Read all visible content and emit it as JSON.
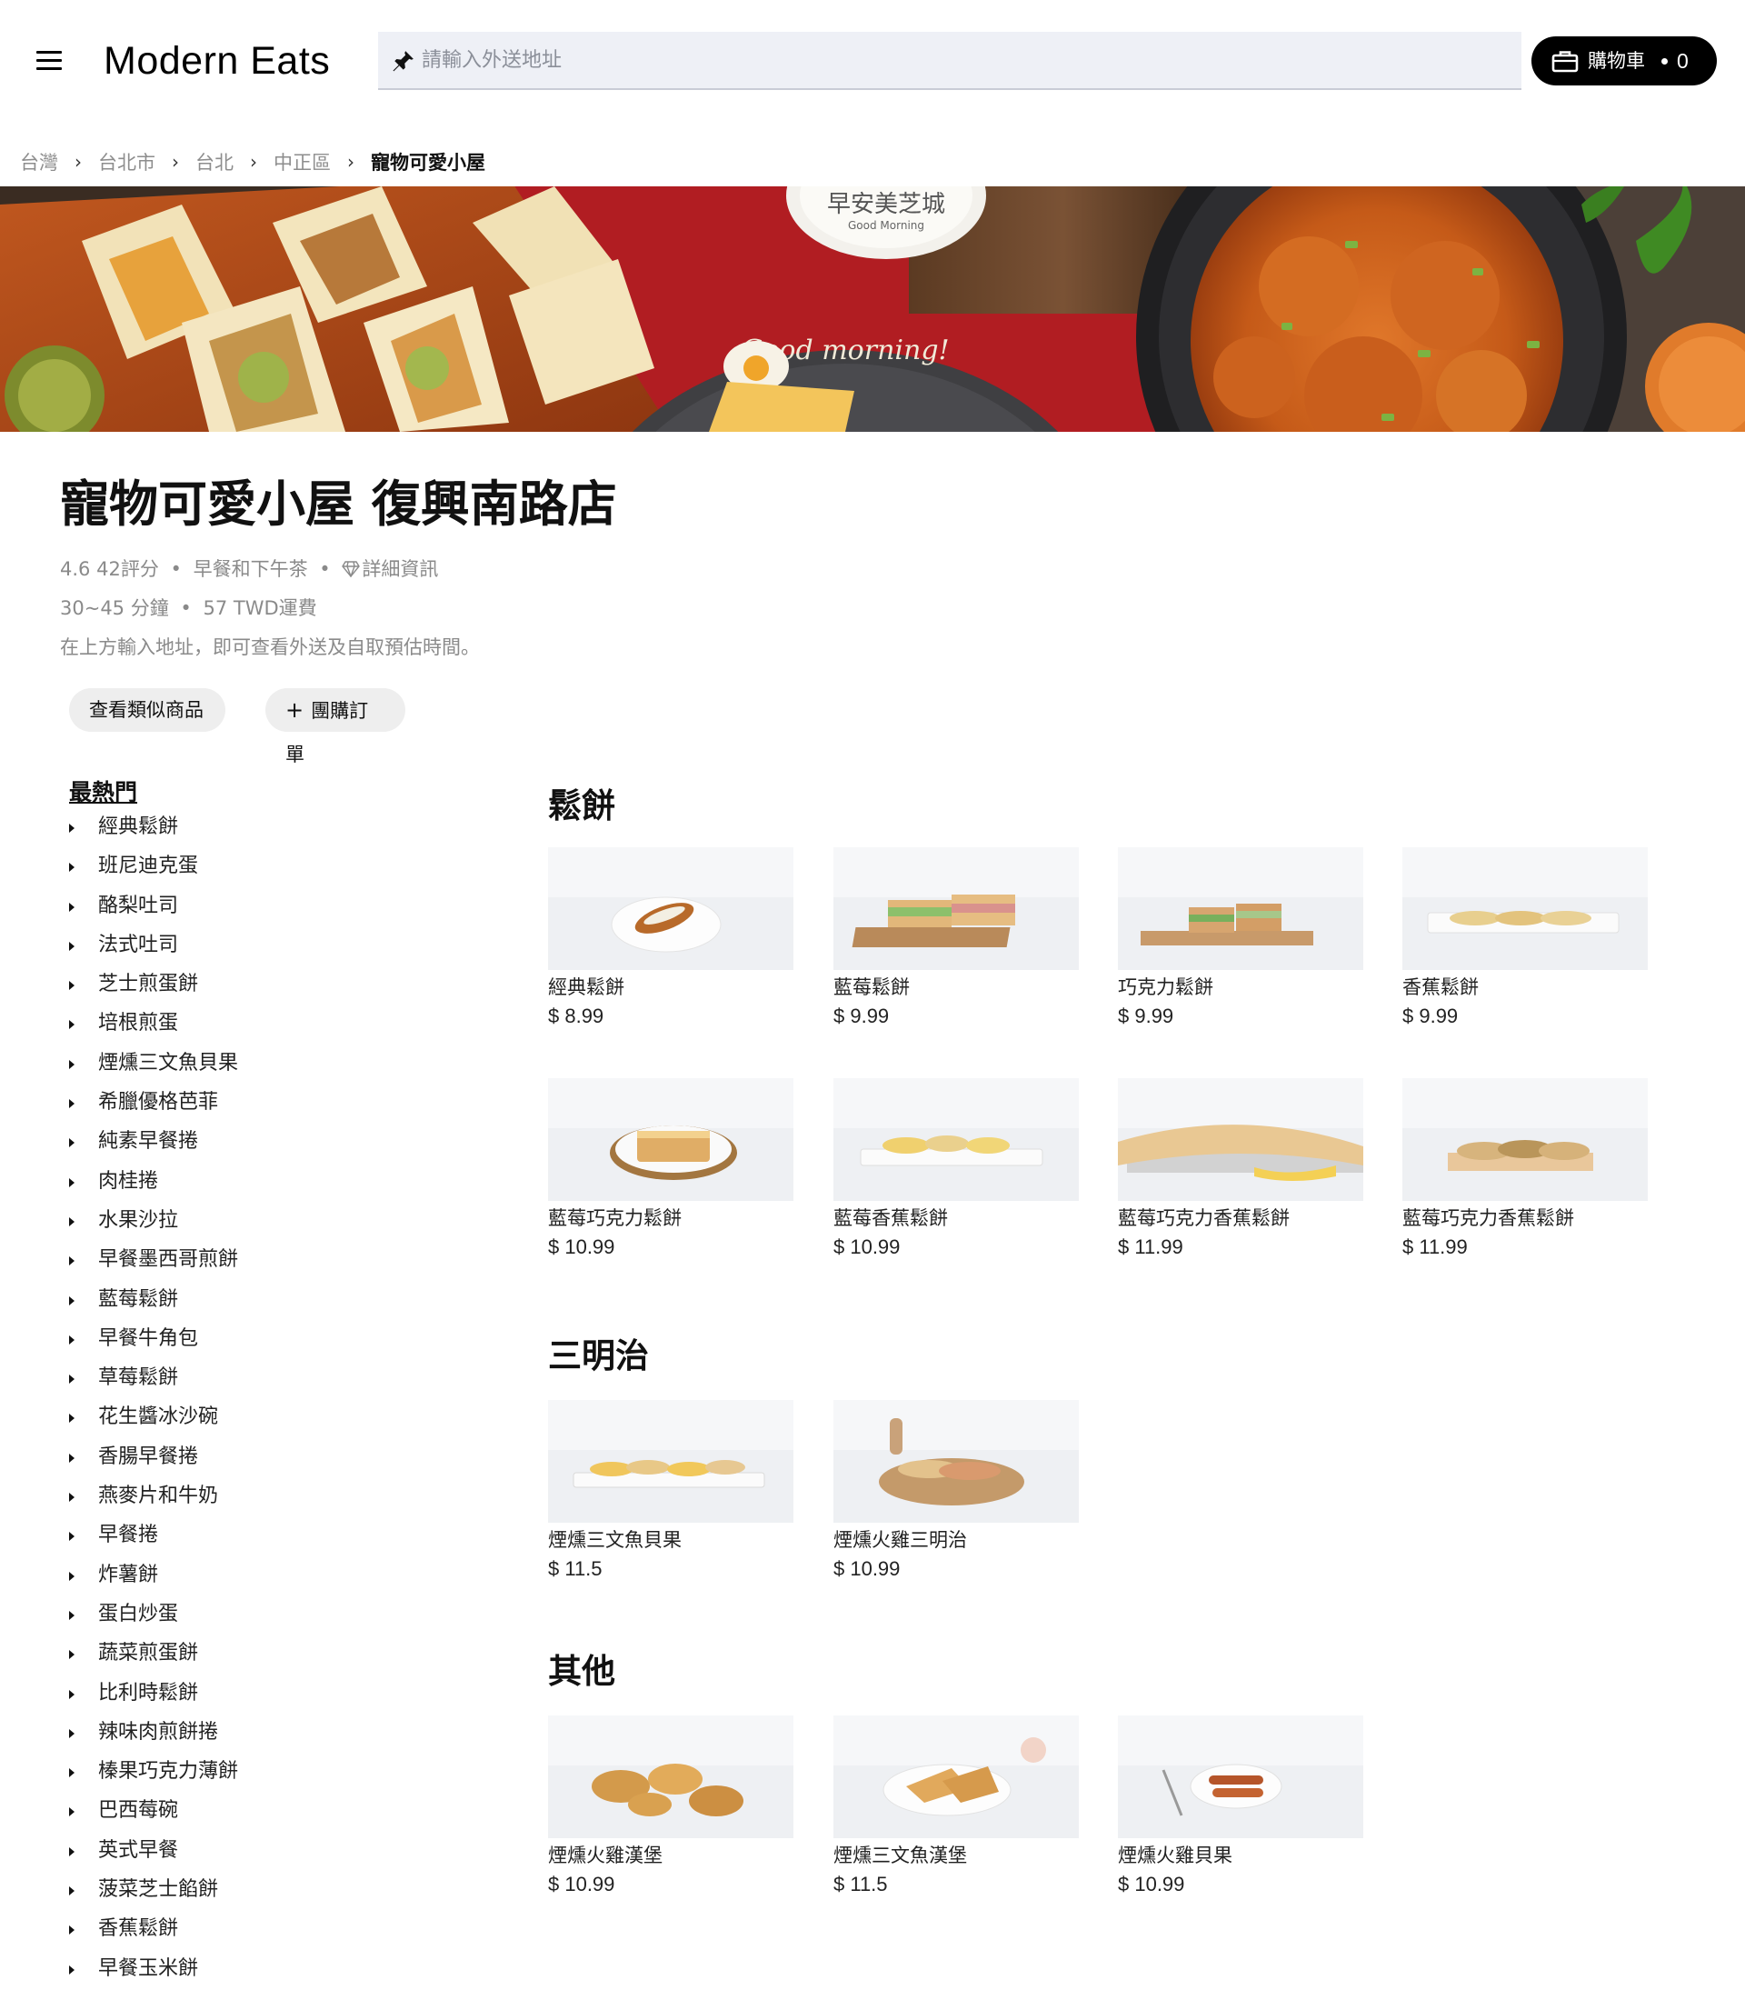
{
  "header": {
    "brand_light": "Modern",
    "brand_bold": "Eats",
    "search_placeholder": "請輸入外送地址",
    "cart_label": "購物車",
    "cart_count": "0"
  },
  "breadcrumb": [
    "台灣",
    "台北市",
    "台北",
    "中正區",
    "寵物可愛小屋"
  ],
  "store": {
    "name": "寵物可愛小屋 復興南路店",
    "rating": "4.6",
    "reviews": "42評分",
    "category": "早餐和下午茶",
    "details": "詳細資訊",
    "delivery_time": "30~45 分鐘",
    "delivery_fee": "57 TWD運費",
    "hint": "在上方輸入地址，即可查看外送及自取預估時間。",
    "btn_similar": "查看類似商品",
    "btn_group_plus": "+",
    "btn_group": "團購訂單"
  },
  "sidebar": {
    "title": "最熱門",
    "items": [
      "經典鬆餅",
      "班尼迪克蛋",
      "酪梨吐司",
      "法式吐司",
      "芝士煎蛋餅",
      "培根煎蛋",
      "煙燻三文魚貝果",
      "希臘優格芭菲",
      "純素早餐捲",
      "肉桂捲",
      "水果沙拉",
      "早餐墨西哥煎餅",
      "藍莓鬆餅",
      "早餐牛角包",
      "草莓鬆餅",
      "花生醬冰沙碗",
      "香腸早餐捲",
      "燕麥片和牛奶",
      "早餐捲",
      "炸薯餅",
      "蛋白炒蛋",
      "蔬菜煎蛋餅",
      "比利時鬆餅",
      "辣味肉煎餅捲",
      "榛果巧克力薄餅",
      "巴西莓碗",
      "英式早餐",
      "菠菜芝士餡餅",
      "香蕉鬆餅",
      "早餐玉米餅"
    ]
  },
  "sections": [
    {
      "title": "鬆餅",
      "items": [
        {
          "name": "經典鬆餅",
          "price": "$ 8.99"
        },
        {
          "name": "藍莓鬆餅",
          "price": "$ 9.99"
        },
        {
          "name": "巧克力鬆餅",
          "price": "$ 9.99"
        },
        {
          "name": "香蕉鬆餅",
          "price": "$ 9.99"
        },
        {
          "name": "藍莓巧克力鬆餅",
          "price": "$ 10.99"
        },
        {
          "name": "藍莓香蕉鬆餅",
          "price": "$ 10.99"
        },
        {
          "name": "藍莓巧克力香蕉鬆餅",
          "price": "$ 11.99"
        },
        {
          "name": "藍莓巧克力香蕉鬆餅",
          "price": "$ 11.99"
        }
      ]
    },
    {
      "title": "三明治",
      "items": [
        {
          "name": "煙燻三文魚貝果",
          "price": "$ 11.5"
        },
        {
          "name": "煙燻火雞三明治",
          "price": "$ 10.99"
        }
      ]
    },
    {
      "title": "其他",
      "items": [
        {
          "name": "煙燻火雞漢堡",
          "price": "$ 10.99"
        },
        {
          "name": "煙燻三文魚漢堡",
          "price": "$ 11.5"
        },
        {
          "name": "煙燻火雞貝果",
          "price": "$ 10.99"
        }
      ]
    }
  ],
  "hero_text": {
    "plate_brand": "早安美芝城",
    "plate_sub": "Good Morning",
    "plate_script": "Good morning!"
  },
  "colors": {
    "accent": "#000000",
    "search_bg": "#eef0f6",
    "pill_bg": "#eeeeee",
    "muted_text": "#8a8a8a"
  }
}
